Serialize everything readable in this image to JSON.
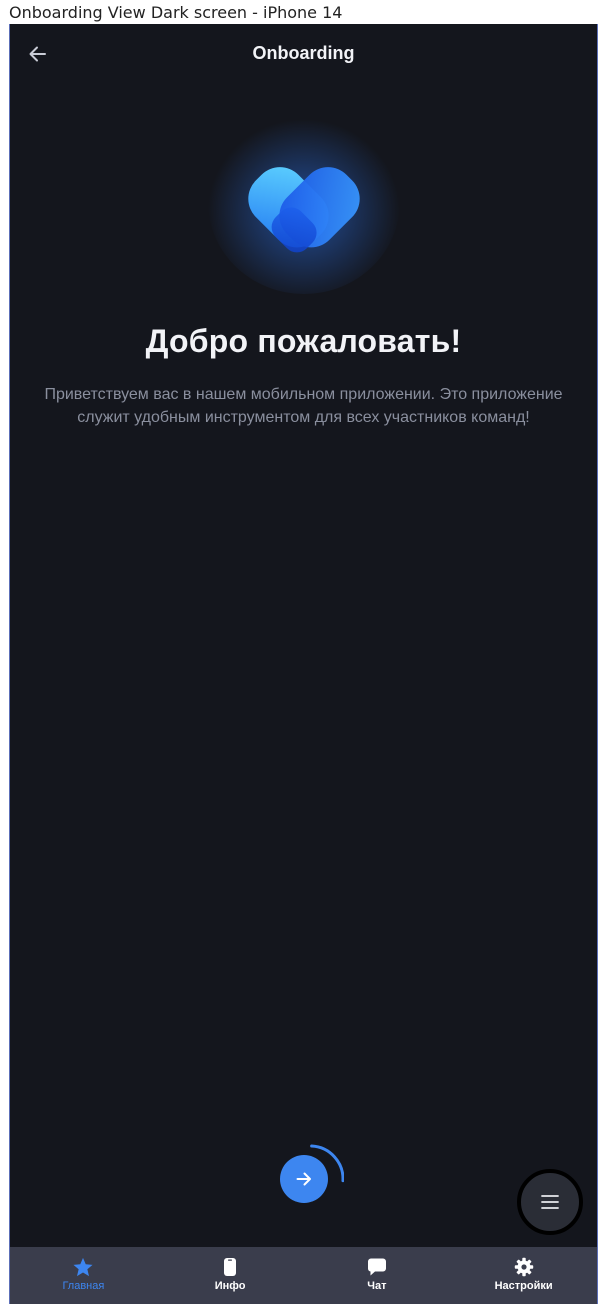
{
  "frame": {
    "title": "Onboarding View Dark screen - iPhone 14"
  },
  "header": {
    "title": "Onboarding",
    "back_icon": "arrow-left-icon"
  },
  "logo": {
    "icon": "heart-logo-icon"
  },
  "welcome": {
    "title": "Добро пожаловать!",
    "text": "Приветствуем вас в нашем мобильном приложении.  Это приложение служит удобным инструментом для всех участников команд!"
  },
  "next_button": {
    "icon": "arrow-right-icon",
    "progress": 0.25
  },
  "fab": {
    "icon": "menu-icon"
  },
  "tabs": [
    {
      "label": "Главная",
      "icon": "star-icon",
      "active": true
    },
    {
      "label": "Инфо",
      "icon": "phone-icon",
      "active": false
    },
    {
      "label": "Чат",
      "icon": "chat-icon",
      "active": false
    },
    {
      "label": "Настройки",
      "icon": "gear-icon",
      "active": false
    }
  ],
  "colors": {
    "background": "#14161d",
    "accent": "#3d86f0",
    "tabbar": "#3a3d4c",
    "text_primary": "#f2f3f7",
    "text_secondary": "#8a8f9e"
  }
}
